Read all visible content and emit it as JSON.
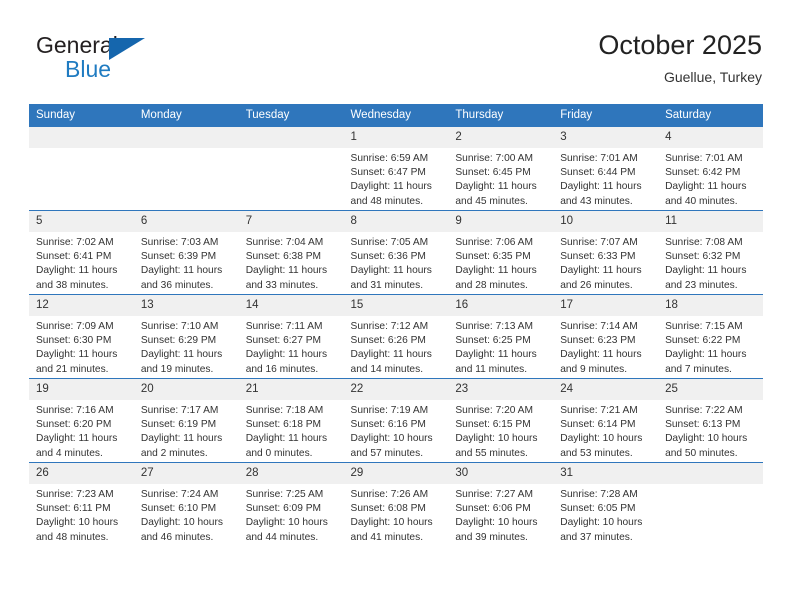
{
  "brand": {
    "name_top": "General",
    "name_bottom": "Blue",
    "triangle_color": "#1566ad",
    "blue_color": "#1f7bc1"
  },
  "header": {
    "title": "October 2025",
    "subtitle": "Guellue, Turkey"
  },
  "theme": {
    "header_blue": "#2f76bc",
    "daynum_bg": "#f0f0f0"
  },
  "weekday_headers": [
    "Sunday",
    "Monday",
    "Tuesday",
    "Wednesday",
    "Thursday",
    "Friday",
    "Saturday"
  ],
  "weeks": [
    [
      {
        "day": "",
        "empty": true
      },
      {
        "day": "",
        "empty": true
      },
      {
        "day": "",
        "empty": true
      },
      {
        "day": "1",
        "sunrise": "Sunrise: 6:59 AM",
        "sunset": "Sunset: 6:47 PM",
        "daylight_1": "Daylight: 11 hours",
        "daylight_2": "and 48 minutes."
      },
      {
        "day": "2",
        "sunrise": "Sunrise: 7:00 AM",
        "sunset": "Sunset: 6:45 PM",
        "daylight_1": "Daylight: 11 hours",
        "daylight_2": "and 45 minutes."
      },
      {
        "day": "3",
        "sunrise": "Sunrise: 7:01 AM",
        "sunset": "Sunset: 6:44 PM",
        "daylight_1": "Daylight: 11 hours",
        "daylight_2": "and 43 minutes."
      },
      {
        "day": "4",
        "sunrise": "Sunrise: 7:01 AM",
        "sunset": "Sunset: 6:42 PM",
        "daylight_1": "Daylight: 11 hours",
        "daylight_2": "and 40 minutes."
      }
    ],
    [
      {
        "day": "5",
        "sunrise": "Sunrise: 7:02 AM",
        "sunset": "Sunset: 6:41 PM",
        "daylight_1": "Daylight: 11 hours",
        "daylight_2": "and 38 minutes."
      },
      {
        "day": "6",
        "sunrise": "Sunrise: 7:03 AM",
        "sunset": "Sunset: 6:39 PM",
        "daylight_1": "Daylight: 11 hours",
        "daylight_2": "and 36 minutes."
      },
      {
        "day": "7",
        "sunrise": "Sunrise: 7:04 AM",
        "sunset": "Sunset: 6:38 PM",
        "daylight_1": "Daylight: 11 hours",
        "daylight_2": "and 33 minutes."
      },
      {
        "day": "8",
        "sunrise": "Sunrise: 7:05 AM",
        "sunset": "Sunset: 6:36 PM",
        "daylight_1": "Daylight: 11 hours",
        "daylight_2": "and 31 minutes."
      },
      {
        "day": "9",
        "sunrise": "Sunrise: 7:06 AM",
        "sunset": "Sunset: 6:35 PM",
        "daylight_1": "Daylight: 11 hours",
        "daylight_2": "and 28 minutes."
      },
      {
        "day": "10",
        "sunrise": "Sunrise: 7:07 AM",
        "sunset": "Sunset: 6:33 PM",
        "daylight_1": "Daylight: 11 hours",
        "daylight_2": "and 26 minutes."
      },
      {
        "day": "11",
        "sunrise": "Sunrise: 7:08 AM",
        "sunset": "Sunset: 6:32 PM",
        "daylight_1": "Daylight: 11 hours",
        "daylight_2": "and 23 minutes."
      }
    ],
    [
      {
        "day": "12",
        "sunrise": "Sunrise: 7:09 AM",
        "sunset": "Sunset: 6:30 PM",
        "daylight_1": "Daylight: 11 hours",
        "daylight_2": "and 21 minutes."
      },
      {
        "day": "13",
        "sunrise": "Sunrise: 7:10 AM",
        "sunset": "Sunset: 6:29 PM",
        "daylight_1": "Daylight: 11 hours",
        "daylight_2": "and 19 minutes."
      },
      {
        "day": "14",
        "sunrise": "Sunrise: 7:11 AM",
        "sunset": "Sunset: 6:27 PM",
        "daylight_1": "Daylight: 11 hours",
        "daylight_2": "and 16 minutes."
      },
      {
        "day": "15",
        "sunrise": "Sunrise: 7:12 AM",
        "sunset": "Sunset: 6:26 PM",
        "daylight_1": "Daylight: 11 hours",
        "daylight_2": "and 14 minutes."
      },
      {
        "day": "16",
        "sunrise": "Sunrise: 7:13 AM",
        "sunset": "Sunset: 6:25 PM",
        "daylight_1": "Daylight: 11 hours",
        "daylight_2": "and 11 minutes."
      },
      {
        "day": "17",
        "sunrise": "Sunrise: 7:14 AM",
        "sunset": "Sunset: 6:23 PM",
        "daylight_1": "Daylight: 11 hours",
        "daylight_2": "and 9 minutes."
      },
      {
        "day": "18",
        "sunrise": "Sunrise: 7:15 AM",
        "sunset": "Sunset: 6:22 PM",
        "daylight_1": "Daylight: 11 hours",
        "daylight_2": "and 7 minutes."
      }
    ],
    [
      {
        "day": "19",
        "sunrise": "Sunrise: 7:16 AM",
        "sunset": "Sunset: 6:20 PM",
        "daylight_1": "Daylight: 11 hours",
        "daylight_2": "and 4 minutes."
      },
      {
        "day": "20",
        "sunrise": "Sunrise: 7:17 AM",
        "sunset": "Sunset: 6:19 PM",
        "daylight_1": "Daylight: 11 hours",
        "daylight_2": "and 2 minutes."
      },
      {
        "day": "21",
        "sunrise": "Sunrise: 7:18 AM",
        "sunset": "Sunset: 6:18 PM",
        "daylight_1": "Daylight: 11 hours",
        "daylight_2": "and 0 minutes."
      },
      {
        "day": "22",
        "sunrise": "Sunrise: 7:19 AM",
        "sunset": "Sunset: 6:16 PM",
        "daylight_1": "Daylight: 10 hours",
        "daylight_2": "and 57 minutes."
      },
      {
        "day": "23",
        "sunrise": "Sunrise: 7:20 AM",
        "sunset": "Sunset: 6:15 PM",
        "daylight_1": "Daylight: 10 hours",
        "daylight_2": "and 55 minutes."
      },
      {
        "day": "24",
        "sunrise": "Sunrise: 7:21 AM",
        "sunset": "Sunset: 6:14 PM",
        "daylight_1": "Daylight: 10 hours",
        "daylight_2": "and 53 minutes."
      },
      {
        "day": "25",
        "sunrise": "Sunrise: 7:22 AM",
        "sunset": "Sunset: 6:13 PM",
        "daylight_1": "Daylight: 10 hours",
        "daylight_2": "and 50 minutes."
      }
    ],
    [
      {
        "day": "26",
        "sunrise": "Sunrise: 7:23 AM",
        "sunset": "Sunset: 6:11 PM",
        "daylight_1": "Daylight: 10 hours",
        "daylight_2": "and 48 minutes."
      },
      {
        "day": "27",
        "sunrise": "Sunrise: 7:24 AM",
        "sunset": "Sunset: 6:10 PM",
        "daylight_1": "Daylight: 10 hours",
        "daylight_2": "and 46 minutes."
      },
      {
        "day": "28",
        "sunrise": "Sunrise: 7:25 AM",
        "sunset": "Sunset: 6:09 PM",
        "daylight_1": "Daylight: 10 hours",
        "daylight_2": "and 44 minutes."
      },
      {
        "day": "29",
        "sunrise": "Sunrise: 7:26 AM",
        "sunset": "Sunset: 6:08 PM",
        "daylight_1": "Daylight: 10 hours",
        "daylight_2": "and 41 minutes."
      },
      {
        "day": "30",
        "sunrise": "Sunrise: 7:27 AM",
        "sunset": "Sunset: 6:06 PM",
        "daylight_1": "Daylight: 10 hours",
        "daylight_2": "and 39 minutes."
      },
      {
        "day": "31",
        "sunrise": "Sunrise: 7:28 AM",
        "sunset": "Sunset: 6:05 PM",
        "daylight_1": "Daylight: 10 hours",
        "daylight_2": "and 37 minutes."
      },
      {
        "day": "",
        "empty": true
      }
    ]
  ]
}
